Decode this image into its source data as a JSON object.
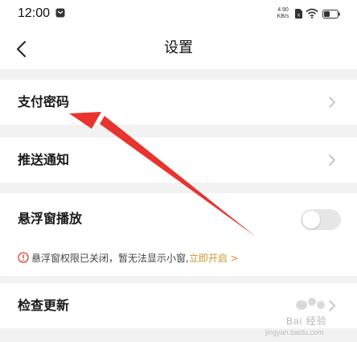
{
  "status_bar": {
    "time": "12:00",
    "net_speed_value": "4.90",
    "net_speed_unit": "KB/s",
    "icons": [
      "message-icon",
      "sim-icon",
      "wifi-icon",
      "battery-icon"
    ]
  },
  "header": {
    "title": "设置",
    "back_icon": "chevron-left-icon"
  },
  "settings": {
    "payment_password": "支付密码",
    "push_notification": "推送通知",
    "floating_window": {
      "label": "悬浮窗播放",
      "enabled": false,
      "warning_text": "悬浮窗权限已关闭，暂无法显示小窗,",
      "warning_link": "立即开启 >"
    },
    "check_update": "检查更新"
  },
  "colors": {
    "arrow": "#e8342e",
    "link": "#c9962a",
    "warning": "#e53935",
    "page_bg": "#f2f2f2"
  },
  "watermark": {
    "brand": "Bai 经验",
    "url": "jingyan.baidu.com"
  }
}
